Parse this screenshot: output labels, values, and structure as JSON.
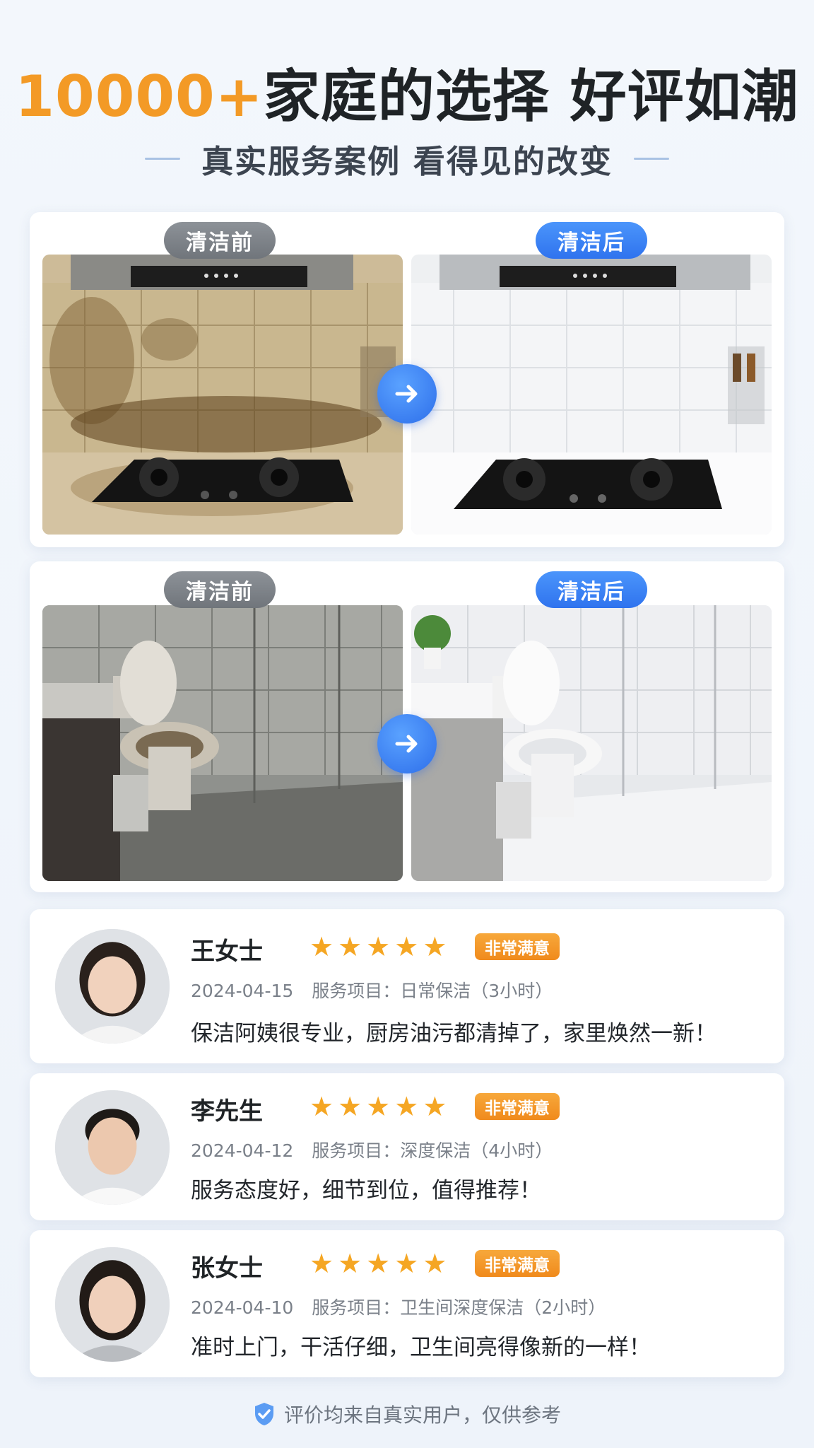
{
  "header": {
    "headline_number": "10000+",
    "headline_rest": "家庭的选择 好评如潮",
    "subtitle": "真实服务案例 看得见的改变"
  },
  "cases": [
    {
      "before_label": "清洁前",
      "after_label": "清洁后",
      "scene": "kitchen"
    },
    {
      "before_label": "清洁前",
      "after_label": "清洁后",
      "scene": "bathroom"
    }
  ],
  "reviews": [
    {
      "name": "王女士",
      "stars": 5,
      "badge": "非常满意",
      "date": "2024-04-15",
      "service": "服务项目：日常保洁（3小时）",
      "comment": "保洁阿姨很专业，厨房油污都清掉了，家里焕然一新！"
    },
    {
      "name": "李先生",
      "stars": 5,
      "badge": "非常满意",
      "date": "2024-04-12",
      "service": "服务项目：深度保洁（4小时）",
      "comment": "服务态度好，细节到位，值得推荐！"
    },
    {
      "name": "张女士",
      "stars": 5,
      "badge": "非常满意",
      "date": "2024-04-10",
      "service": "服务项目：卫生间深度保洁（2小时）",
      "comment": "准时上门，干活仔细，卫生间亮得像新的一样！"
    }
  ],
  "footer": {
    "note": "评价均来自真实用户，仅供参考"
  },
  "colors": {
    "accent_orange": "#f39a26",
    "accent_blue": "#2f73ee",
    "star": "#f5a623"
  },
  "icons": {
    "arrow": "arrow-right-icon",
    "star": "star-icon",
    "shield": "shield-check-icon"
  }
}
